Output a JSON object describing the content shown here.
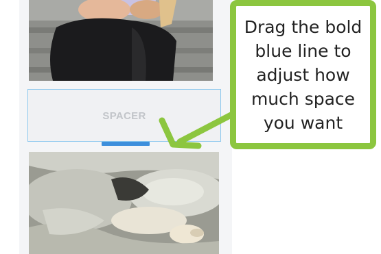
{
  "spacer": {
    "label": "SPACER"
  },
  "callout": {
    "lines": [
      "Drag the bold",
      "blue line to",
      "adjust how",
      "much space",
      "you want"
    ]
  },
  "colors": {
    "accent_green": "#8cc63f",
    "handle_blue": "#3d8fdc",
    "spacer_border": "#8cc8ee"
  },
  "images": {
    "top": "photo-woman-seated-on-steps",
    "bottom": "photo-dog-on-bed-pillows"
  }
}
